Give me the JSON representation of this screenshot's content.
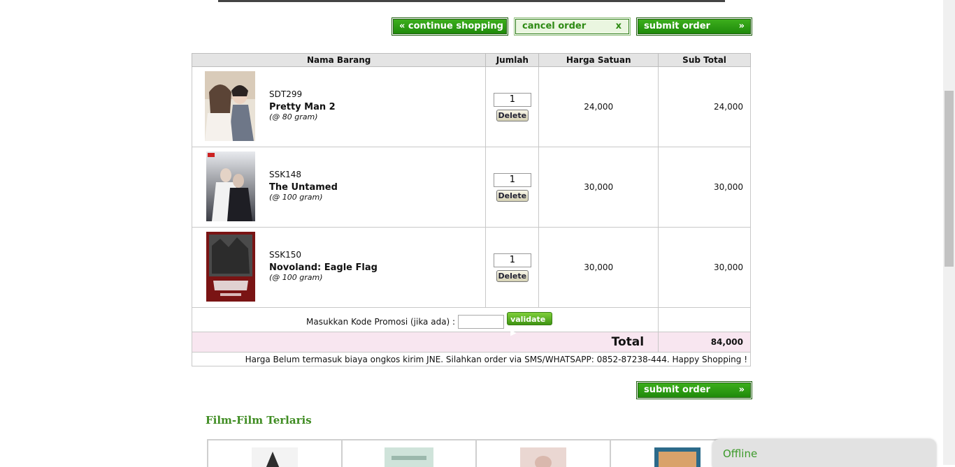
{
  "toolbar": {
    "continue_label": "« continue shopping",
    "cancel_label": "cancel order",
    "cancel_x": "x",
    "submit_label": "submit order",
    "submit_arrow": "»"
  },
  "cart": {
    "headers": [
      "Nama Barang",
      "Jumlah",
      "Harga Satuan",
      "Sub Total"
    ],
    "items": [
      {
        "sku": "SDT299",
        "name": "Pretty Man 2",
        "weight": "(@ 80 gram)",
        "qty": "1",
        "delete": "Delete",
        "price": "24,000",
        "subtotal": "24,000"
      },
      {
        "sku": "SSK148",
        "name": "The Untamed",
        "weight": "(@ 100 gram)",
        "qty": "1",
        "delete": "Delete",
        "price": "30,000",
        "subtotal": "30,000"
      },
      {
        "sku": "SSK150",
        "name": "Novoland: Eagle Flag",
        "weight": "(@ 100 gram)",
        "qty": "1",
        "delete": "Delete",
        "price": "30,000",
        "subtotal": "30,000"
      }
    ],
    "promo_label": "Masukkan Kode Promosi (jika ada) :",
    "validate_label": "validate ▶",
    "total_label": "Total",
    "total_value": "84,000",
    "note": "Harga Belum termasuk biaya ongkos kirim JNE. Silahkan order via SMS/WHATSAPP: 0852-87238-444. Happy Shopping !"
  },
  "bottom": {
    "submit_label": "submit order",
    "submit_arrow": "»",
    "section_title": "Film-Film Terlaris"
  },
  "chat": {
    "status": "Offline"
  },
  "colors": {
    "accent_green": "#2d8a13",
    "total_bg": "#f8e6f0"
  }
}
